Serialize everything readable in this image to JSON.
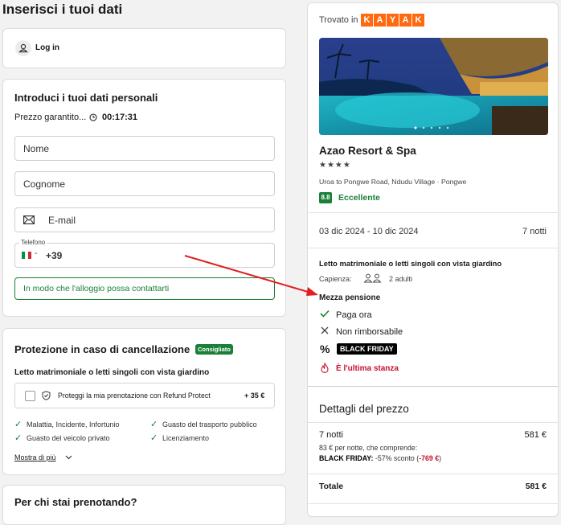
{
  "page_title": "Inserisci i tuoi dati",
  "login": {
    "label": "Log in"
  },
  "personal": {
    "title": "Introduci i tuoi dati personali",
    "price_guarantee": "Prezzo garantito...",
    "timer": "00:17:31",
    "name_placeholder": "Nome",
    "surname_placeholder": "Cognome",
    "email_placeholder": "E-mail",
    "phone_label": "Telefono",
    "phone_prefix": "+39",
    "phone_hint": "In modo che l'alloggio possa contattarti"
  },
  "protection": {
    "title": "Protezione in caso di cancellazione",
    "badge": "Consigliato",
    "room": "Letto matrimoniale o letti singoli con vista giardino",
    "option_label": "Proteggi la mia prenotazione con Refund Protect",
    "option_price": "+ 35 €",
    "coverage": [
      "Malattia, Incidente, Infortunio",
      "Guasto del trasporto pubblico",
      "Guasto del veicolo privato",
      "Licenziamento"
    ],
    "show_more": "Mostra di più"
  },
  "booking_for": {
    "title": "Per chi stai prenotando?"
  },
  "hotel": {
    "found_in": "Trovato in",
    "brand_letters": [
      "K",
      "A",
      "Y",
      "A",
      "K"
    ],
    "brand_color": "#ff690f",
    "name": "Azao Resort & Spa",
    "stars": "★★★★",
    "address": "Uroa to Pongwe Road, Ndudu Village · Pongwe",
    "score": "8.8",
    "rating_label": "Eccellente",
    "dates": "03 dic 2024 - 10 dic 2024",
    "nights": "7 notti",
    "room": "Letto matrimoniale o letti singoli con vista giardino",
    "capacity_label": "Capienza:",
    "capacity_value": "2 adulti",
    "board": "Mezza pensione",
    "pay_now": "Paga ora",
    "non_refundable": "Non rimborsabile",
    "deal_badge": "BLACK FRIDAY",
    "last_room": "È l'ultima stanza"
  },
  "price": {
    "title": "Dettagli del prezzo",
    "nights_label": "7 notti",
    "nights_amount": "581 €",
    "per_night": "83 € per notte, che comprende:",
    "discount_label": "BLACK FRIDAY:",
    "discount_text": "-57% sconto (",
    "discount_amount": "-769 €",
    "discount_close": ")",
    "total_label": "Totale",
    "total_amount": "581 €"
  }
}
